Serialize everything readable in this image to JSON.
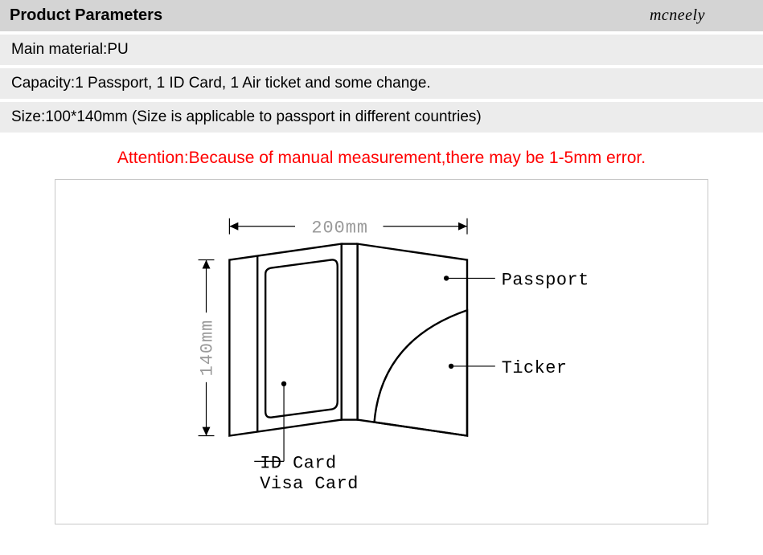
{
  "header": {
    "title": "Product Parameters",
    "brand": "mcneely"
  },
  "specs": {
    "row1": "Main material:PU",
    "row2": "Capacity:1 Passport, 1 ID Card, 1 Air ticket and some change.",
    "row3": "Size:100*140mm (Size is applicable to passport in different countries)"
  },
  "attention": "Attention:Because of manual measurement,there may be 1-5mm error.",
  "dims": {
    "width": "200mm",
    "height": "140mm"
  },
  "callouts": {
    "passport": "Passport",
    "ticker": "Ticker",
    "idcard_l1": "ID Card",
    "idcard_l2": "Visa Card"
  }
}
